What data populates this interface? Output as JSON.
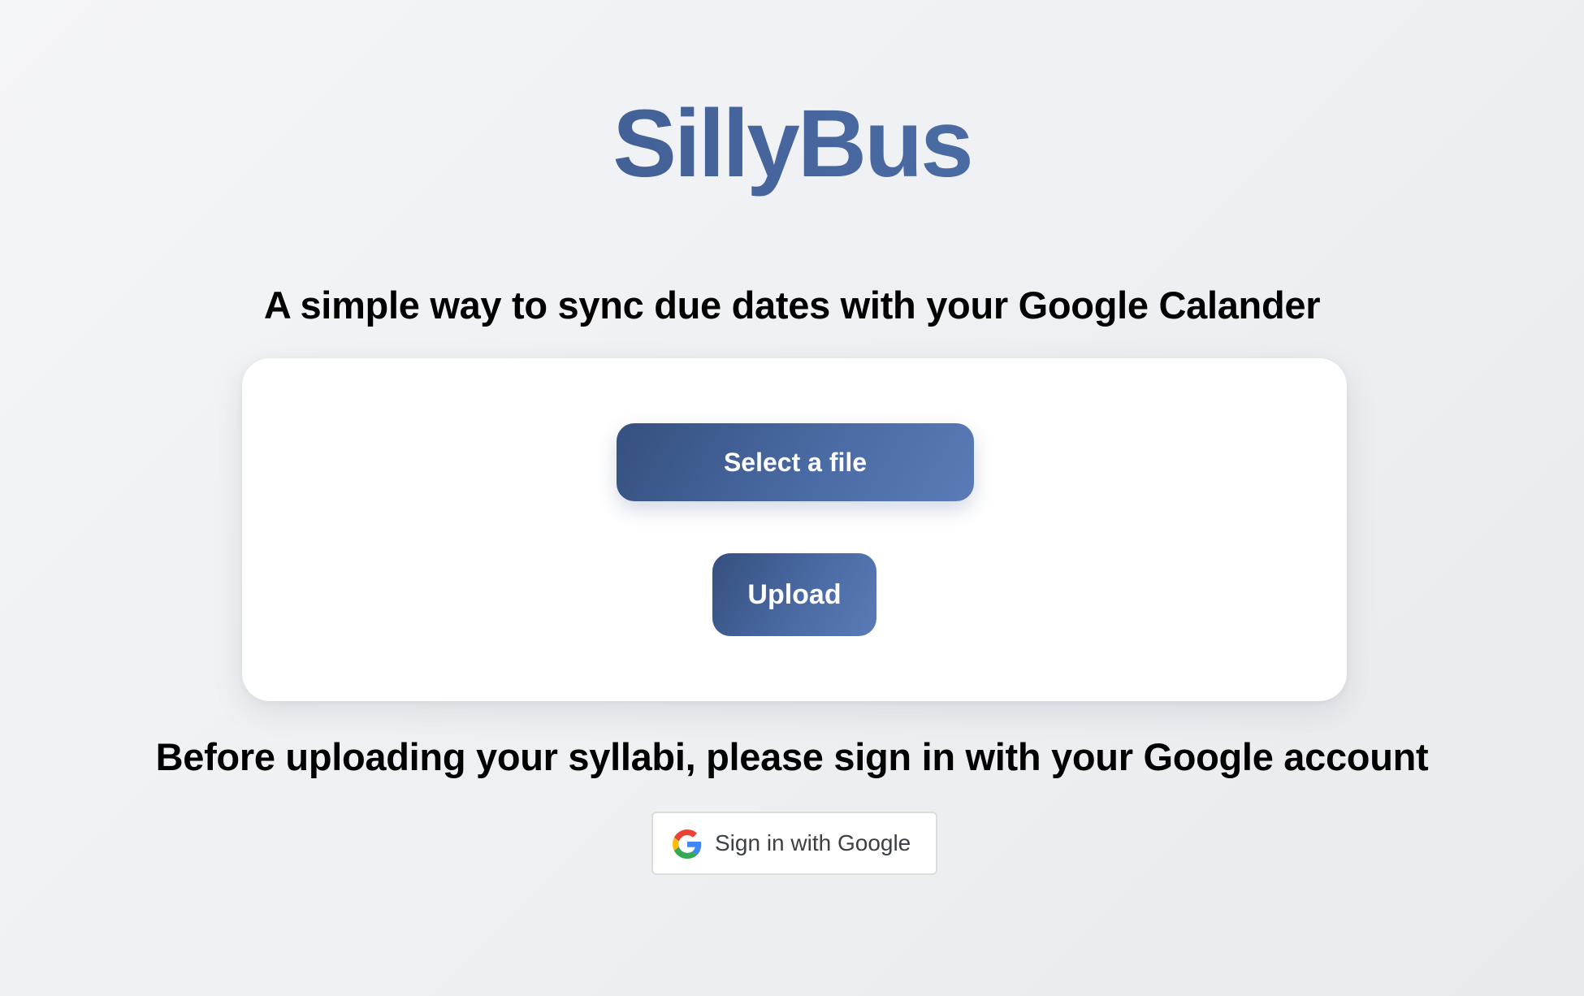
{
  "app": {
    "title": "SillyBus"
  },
  "main": {
    "subtitle": "A simple way to sync due dates with your Google Calander",
    "select_file_label": "Select a file",
    "upload_label": "Upload",
    "notice": "Before uploading your syllabi, please sign in with your Google account"
  },
  "google_signin": {
    "label": "Sign in with Google",
    "icon": "google-g-icon"
  },
  "colors": {
    "brand_dark": "#35507f",
    "brand_light": "#5b7bb8",
    "background": "#eef0f3",
    "card": "#ffffff",
    "google_border": "#dadce0",
    "google_text": "#3c4043"
  }
}
